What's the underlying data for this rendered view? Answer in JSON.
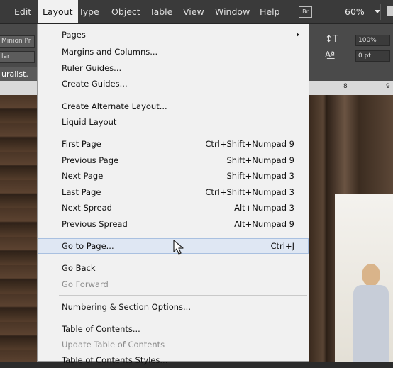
{
  "menubar": {
    "items": [
      "Edit",
      "Layout",
      "Type",
      "Object",
      "Table",
      "View",
      "Window",
      "Help"
    ],
    "bridge_badge": "Br",
    "zoom": "60%"
  },
  "left_panel": {
    "font_field": "Minion Pr",
    "style_field": "lar",
    "doc_tab": "uralist."
  },
  "right_panel": {
    "scale_value": "100%",
    "baseline_value": "0 pt",
    "ruler_marks": [
      "8",
      "9"
    ]
  },
  "layout_menu": {
    "items": [
      {
        "label": "Pages",
        "shortcut": "",
        "submenu": true
      },
      {
        "label": "Margins and Columns...",
        "shortcut": ""
      },
      {
        "label": "Ruler Guides...",
        "shortcut": ""
      },
      {
        "label": "Create Guides...",
        "shortcut": ""
      },
      {
        "label": "Create Alternate Layout...",
        "shortcut": ""
      },
      {
        "label": "Liquid Layout",
        "shortcut": ""
      },
      {
        "label": "First Page",
        "shortcut": "Ctrl+Shift+Numpad 9"
      },
      {
        "label": "Previous Page",
        "shortcut": "Shift+Numpad 9"
      },
      {
        "label": "Next Page",
        "shortcut": "Shift+Numpad 3"
      },
      {
        "label": "Last Page",
        "shortcut": "Ctrl+Shift+Numpad 3"
      },
      {
        "label": "Next Spread",
        "shortcut": "Alt+Numpad 3"
      },
      {
        "label": "Previous Spread",
        "shortcut": "Alt+Numpad 9"
      },
      {
        "label": "Go to Page...",
        "shortcut": "Ctrl+J",
        "highlighted": true
      },
      {
        "label": "Go Back",
        "shortcut": ""
      },
      {
        "label": "Go Forward",
        "shortcut": "",
        "disabled": true
      },
      {
        "label": "Numbering & Section Options...",
        "shortcut": ""
      },
      {
        "label": "Table of Contents...",
        "shortcut": ""
      },
      {
        "label": "Update Table of Contents",
        "shortcut": "",
        "disabled": true
      },
      {
        "label": "Table of Contents Styles...",
        "shortcut": ""
      }
    ]
  },
  "colors": {
    "menu_bg": "#f1f1f1",
    "menubar_bg": "#3a3a3a",
    "highlight": "#dfe7f3"
  }
}
